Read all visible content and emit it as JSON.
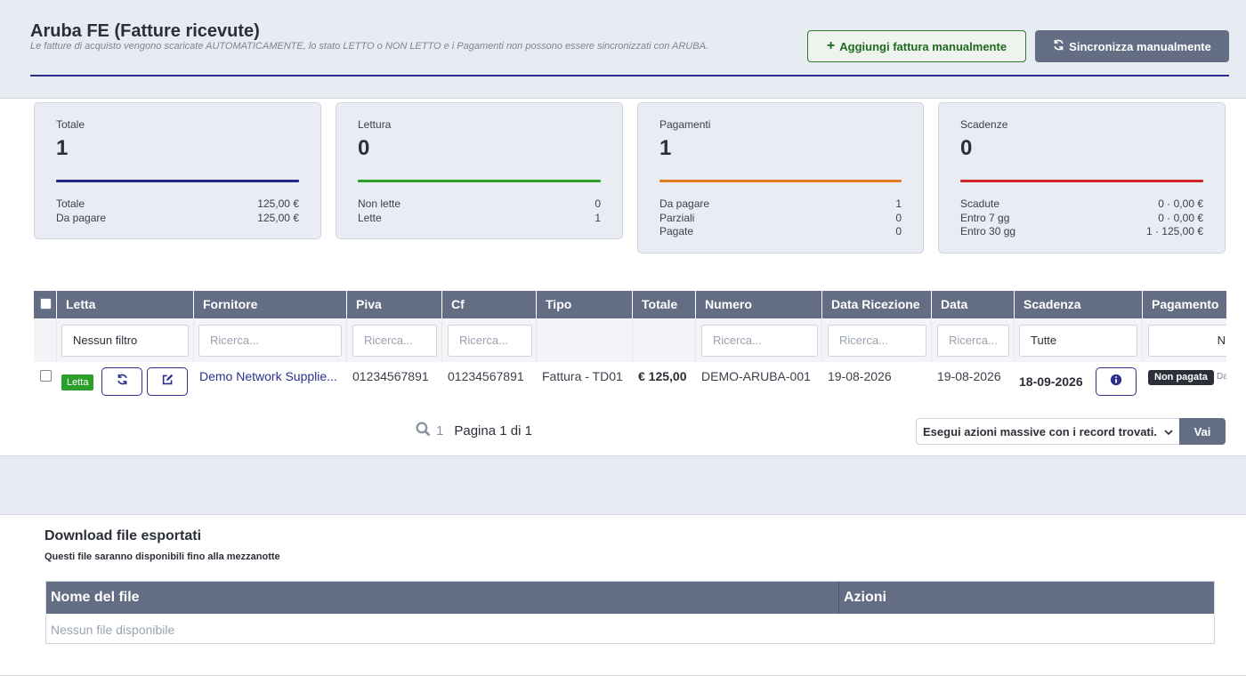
{
  "header": {
    "title": "Aruba FE (Fatture ricevute)",
    "subtitle": "Le fatture di acquisto vengono scaricate AUTOMATICAMENTE, lo stato LETTO o NON LETTO e i Pagamenti non possono essere sincronizzati con ARUBA.",
    "add_button": "Aggiungi fattura manualmente",
    "sync_button": "Sincronizza manualmente"
  },
  "cards": [
    {
      "label": "Totale",
      "value": "1",
      "color": "#23278a",
      "rows": [
        [
          "Totale",
          "125,00 €"
        ],
        [
          "Da pagare",
          "125,00 €"
        ]
      ]
    },
    {
      "label": "Lettura",
      "value": "0",
      "color": "#2aa02a",
      "rows": [
        [
          "Non lette",
          "0"
        ],
        [
          "Lette",
          "1"
        ]
      ]
    },
    {
      "label": "Pagamenti",
      "value": "1",
      "color": "#e07b22",
      "rows": [
        [
          "Da pagare",
          "1"
        ],
        [
          "Parziali",
          "0"
        ],
        [
          "Pagate",
          "0"
        ]
      ]
    },
    {
      "label": "Scadenze",
      "value": "0",
      "color": "#d2262a",
      "rows": [
        [
          "Scadute",
          "0 · 0,00 €"
        ],
        [
          "Entro 7 gg",
          "0 · 0,00 €"
        ],
        [
          "Entro 30 gg",
          "1 · 125,00 €"
        ]
      ]
    }
  ],
  "table": {
    "columns": [
      "Letta",
      "Fornitore",
      "Piva",
      "Cf",
      "Tipo",
      "Totale",
      "Numero",
      "Data Ricezione",
      "Data",
      "Scadenza",
      "Pagamento"
    ],
    "filters": {
      "letta": "Nessun filtro",
      "search_placeholder": "Ricerca...",
      "scadenza": "Tutte",
      "pagamento": "N"
    },
    "row": {
      "status": "Letta",
      "fornitore": "Demo Network Supplie...",
      "piva": "01234567891",
      "cf": "01234567891",
      "tipo": "Fattura - TD01",
      "totale": "€ 125,00",
      "numero": "DEMO-ARUBA-001",
      "data_ricezione": "19-08-2026",
      "data": "19-08-2026",
      "scadenza": "18-09-2026",
      "pagamento": "Non pagata",
      "pagamento_extra": "Da"
    }
  },
  "pagination": {
    "count": "1",
    "label": "Pagina 1 di 1",
    "bulk_select": "Esegui azioni massive con i record trovati.",
    "go_button": "Vai"
  },
  "downloads": {
    "title": "Download file esportati",
    "subtitle": "Questi file saranno disponibili fino alla mezzanotte",
    "columns": [
      "Nome del file",
      "Azioni"
    ],
    "empty": "Nessun file disponibile"
  },
  "icons": [
    "plus-icon",
    "sync-icon",
    "refresh-icon",
    "edit-icon",
    "info-icon",
    "search-icon",
    "chevron-down-icon"
  ]
}
